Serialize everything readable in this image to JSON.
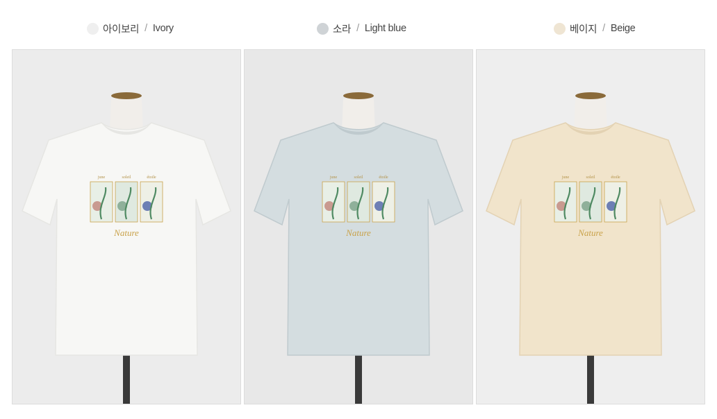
{
  "colors": [
    {
      "ko": "아이보리",
      "sep": "/",
      "en": "Ivory",
      "swatch": "#efefef",
      "shirt": "#f7f7f5",
      "shirt_shadow": "#e6e6e3",
      "background": "#ececec"
    },
    {
      "ko": "소라",
      "sep": "/",
      "en": "Light blue",
      "swatch": "#cfd3d6",
      "shirt": "#d4dde0",
      "shirt_shadow": "#bfcace",
      "background": "#e8e8e8"
    },
    {
      "ko": "베이지",
      "sep": "/",
      "en": "Beige",
      "swatch": "#efe5d3",
      "shirt": "#f1e4cb",
      "shirt_shadow": "#e3d2b3",
      "background": "#eeeeee"
    }
  ],
  "print": {
    "words": [
      "june",
      "soleil",
      "étoile"
    ],
    "script": "Nature"
  },
  "icons": {
    "swatch_dot": "color-swatch-icon"
  }
}
